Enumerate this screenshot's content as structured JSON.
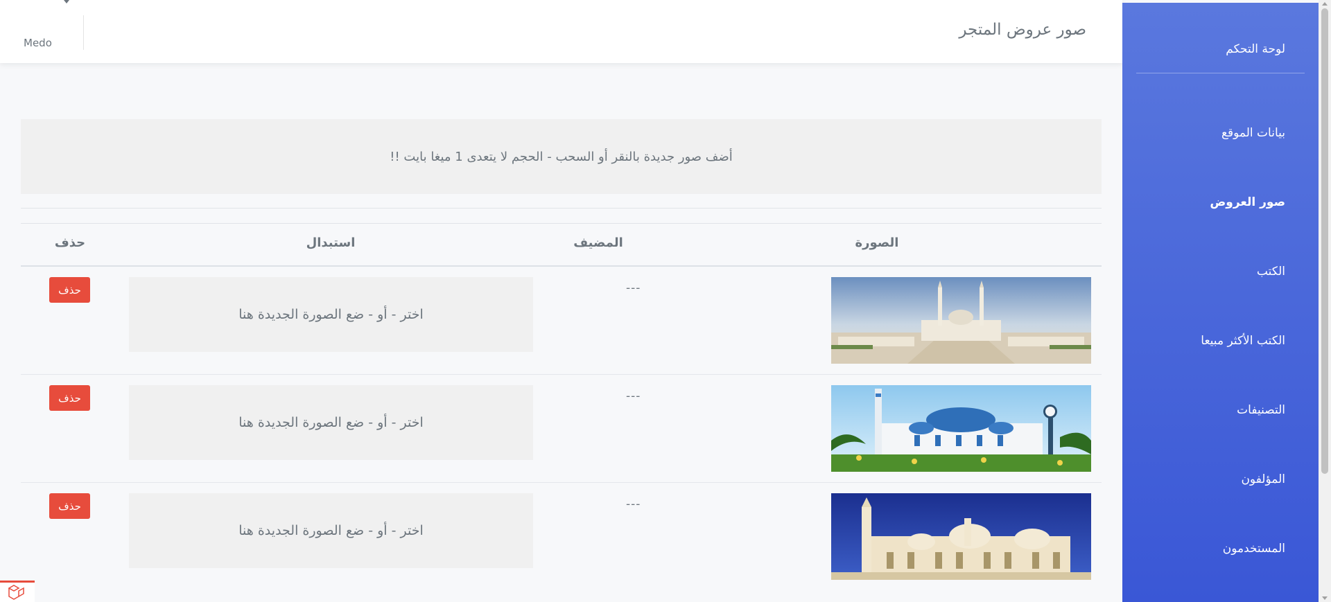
{
  "header": {
    "title": "صور عروض المتجر",
    "user_name": "Medo"
  },
  "sidebar": {
    "items": [
      {
        "label": "لوحة التحكم"
      },
      {
        "label": "بيانات الموقع"
      },
      {
        "label": "صور العروض",
        "active": true
      },
      {
        "label": "الكتب"
      },
      {
        "label": "الكتب الأكثر مبيعا"
      },
      {
        "label": "التصنيفات"
      },
      {
        "label": "المؤلفون"
      },
      {
        "label": "المستخدمون"
      }
    ]
  },
  "dropzone": {
    "text": "أضف صور جديدة بالنقر أو السحب - الحجم لا يتعدى 1 ميغا بايت !!"
  },
  "table": {
    "headers": {
      "image": "الصورة",
      "adder": "المضيف",
      "replace": "استبدال",
      "delete": "حذف"
    },
    "rows": [
      {
        "adder": "---",
        "replace_text": "اختر - أو - ضع الصورة الجديدة هنا",
        "delete_label": "حذف"
      },
      {
        "adder": "---",
        "replace_text": "اختر - أو - ضع الصورة الجديدة هنا",
        "delete_label": "حذف"
      },
      {
        "adder": "---",
        "replace_text": "اختر - أو - ضع الصورة الجديدة هنا",
        "delete_label": "حذف"
      }
    ]
  },
  "colors": {
    "sidebar_top": "#5a78de",
    "sidebar_bottom": "#3a57d6",
    "delete": "#e74c3c",
    "zone_bg": "#f0f0f0"
  },
  "icons": [
    "chevron-down-icon",
    "framework-logo-icon"
  ]
}
